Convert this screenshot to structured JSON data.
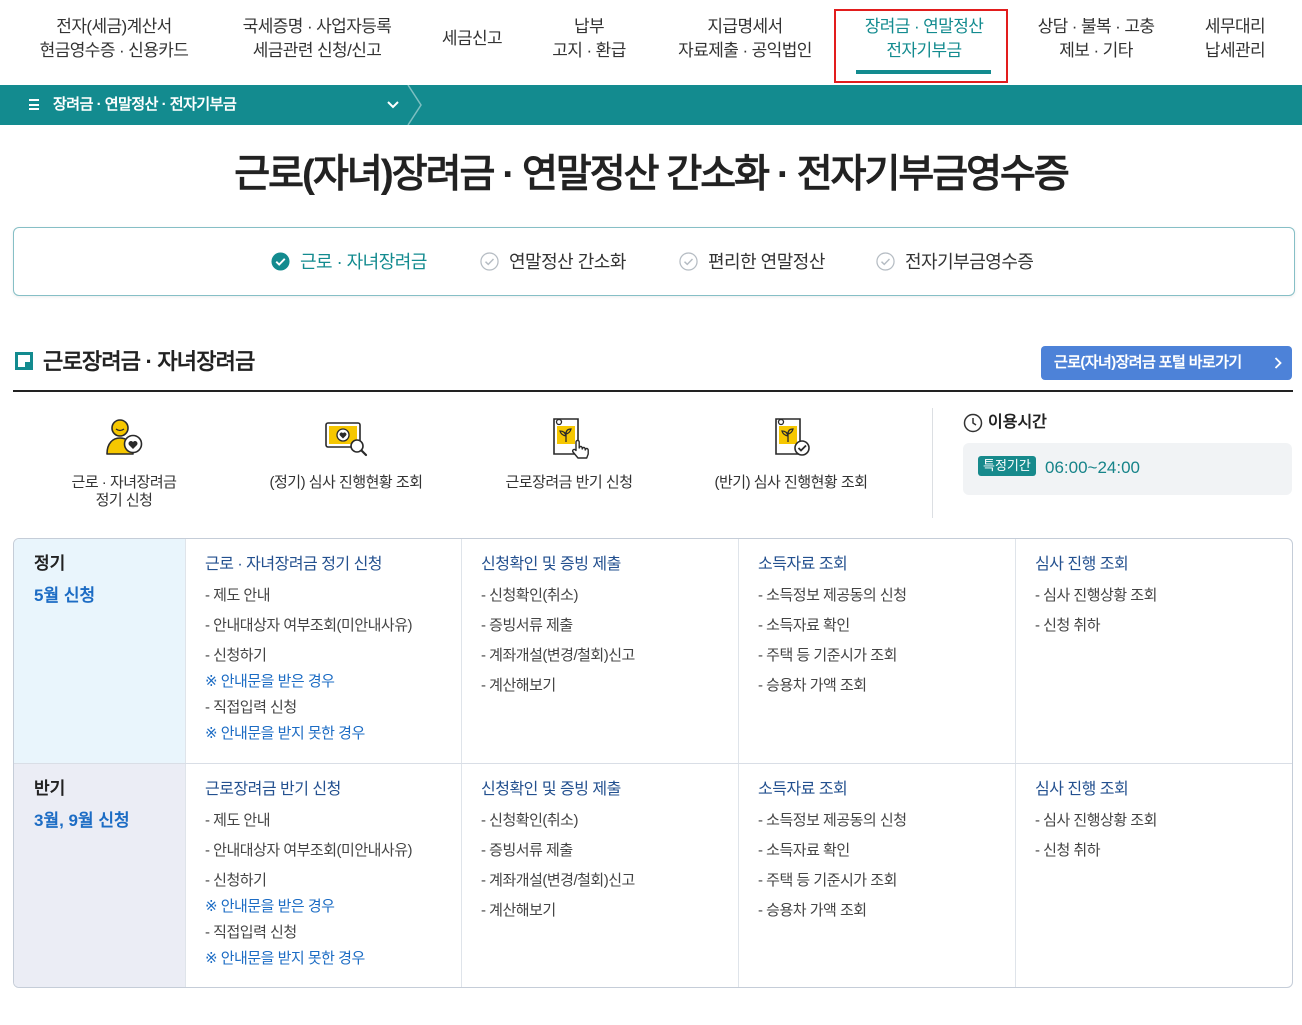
{
  "colors": {
    "accent_teal": "#138b8f",
    "title_text": "#222222",
    "link_navy": "#23508f",
    "note_blue": "#1c6cc4",
    "portal_button_blue": "#4d82d8",
    "highlight_red": "#e21d1d",
    "regular_row_bg": "#e9f5fc",
    "half_year_row_bg": "#ebedf5"
  },
  "gnb": {
    "active_index": 5,
    "items": [
      {
        "line1": "전자(세금)계산서",
        "line2": "현금영수증 · 신용카드"
      },
      {
        "line1": "국세증명 · 사업자등록",
        "line2": "세금관련 신청/신고"
      },
      {
        "line1": "세금신고"
      },
      {
        "line1": "납부",
        "line2": "고지 · 환급"
      },
      {
        "line1": "지급명세서",
        "line2": "자료제출 · 공익법인"
      },
      {
        "line1": "장려금 · 연말정산",
        "line2": "전자기부금"
      },
      {
        "line1": "상담 · 불복 · 고충",
        "line2": "제보 · 기타"
      },
      {
        "line1": "세무대리",
        "line2": "납세관리"
      }
    ]
  },
  "subnav": {
    "menu_icon": "hamburger-icon",
    "label": "장려금 · 연말정산 · 전자기부금",
    "toggle_icon": "chevron-down-icon"
  },
  "page_title": "근로(자녀)장려금 · 연말정산 간소화 · 전자기부금영수증",
  "tabs": [
    {
      "label": "근로 · 자녀장려금",
      "selected": true,
      "icon": "check-circle-icon"
    },
    {
      "label": "연말정산 간소화",
      "selected": false,
      "icon": "check-circle-icon"
    },
    {
      "label": "편리한 연말정산",
      "selected": false,
      "icon": "check-circle-icon"
    },
    {
      "label": "전자기부금영수증",
      "selected": false,
      "icon": "check-circle-icon"
    }
  ],
  "section": {
    "title": "근로장려금 · 자녀장려금",
    "portal_button": {
      "label": "근로(자녀)장려금 포털 바로가기",
      "icon": "chevron-right-icon"
    }
  },
  "quick_links": [
    {
      "icon": "person-heart-icon",
      "lines": [
        "근로 · 자녀장려금",
        "정기 신청"
      ]
    },
    {
      "icon": "monitor-search-icon",
      "lines": [
        "(정기) 심사 진행현황 조회"
      ]
    },
    {
      "icon": "document-click-icon",
      "lines": [
        "근로장려금 반기 신청"
      ]
    },
    {
      "icon": "document-check-icon",
      "lines": [
        "(반기) 심사 진행현황 조회"
      ]
    }
  ],
  "hours": {
    "icon": "clock-icon",
    "title": "이용시간",
    "badge": "특정기간",
    "time": "06:00~24:00"
  },
  "table": {
    "rows": [
      {
        "type": "정기",
        "period": "5월 신청",
        "cells": [
          {
            "title": "근로 · 자녀장려금 정기 신청",
            "items": [
              "- 제도 안내",
              "- 안내대상자 여부조회(미안내사유)",
              "- 신청하기",
              "※ 안내문을 받은 경우",
              "- 직접입력 신청",
              "※ 안내문을 받지 못한 경우"
            ]
          },
          {
            "title": "신청확인 및 증빙 제출",
            "items": [
              "- 신청확인(취소)",
              "- 증빙서류 제출",
              "- 계좌개설(변경/철회)신고",
              "- 계산해보기"
            ]
          },
          {
            "title": "소득자료 조회",
            "items": [
              "- 소득정보 제공동의 신청",
              "- 소득자료 확인",
              "- 주택 등 기준시가 조회",
              "- 승용차 가액 조회"
            ]
          },
          {
            "title": "심사 진행 조회",
            "items": [
              "- 심사 진행상황 조회",
              "- 신청 취하"
            ]
          }
        ]
      },
      {
        "type": "반기",
        "period": "3월, 9월 신청",
        "cells": [
          {
            "title": "근로장려금 반기 신청",
            "items": [
              "- 제도 안내",
              "- 안내대상자 여부조회(미안내사유)",
              "- 신청하기",
              "※ 안내문을 받은 경우",
              "- 직접입력 신청",
              "※ 안내문을 받지 못한 경우"
            ]
          },
          {
            "title": "신청확인 및 증빙 제출",
            "items": [
              "- 신청확인(취소)",
              "- 증빙서류 제출",
              "- 계좌개설(변경/철회)신고",
              "- 계산해보기"
            ]
          },
          {
            "title": "소득자료 조회",
            "items": [
              "- 소득정보 제공동의 신청",
              "- 소득자료 확인",
              "- 주택 등 기준시가 조회",
              "- 승용차 가액 조회"
            ]
          },
          {
            "title": "심사 진행 조회",
            "items": [
              "- 심사 진행상황 조회",
              "- 신청 취하"
            ]
          }
        ]
      }
    ]
  }
}
